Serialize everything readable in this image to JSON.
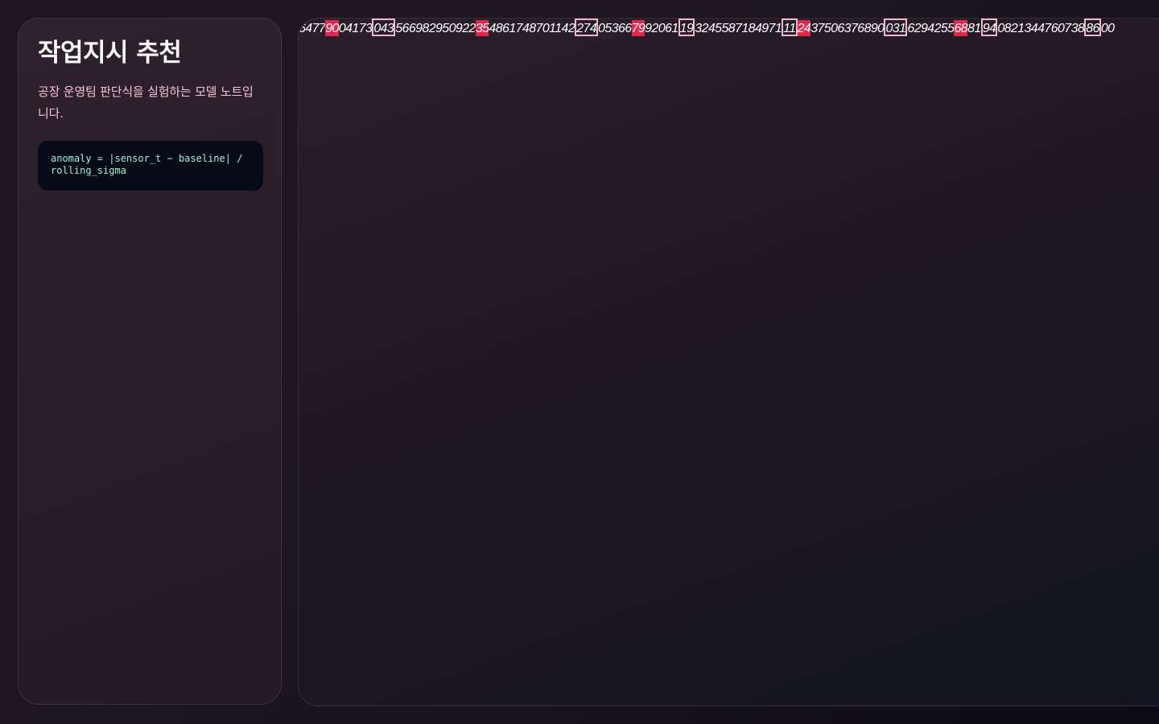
{
  "sidebar": {
    "title": "작업지시 추천",
    "description": "공장 운영팀 판단식을 실험하는 모델 노트입니다.",
    "formula": "anomaly = |sensor_t − baseline| / rolling_sigma"
  },
  "digit_strip": {
    "segments": [
      {
        "text": "6477",
        "style": "plain"
      },
      {
        "text": "90",
        "style": "red"
      },
      {
        "text": "04173",
        "style": "plain"
      },
      {
        "text": "043",
        "style": "box"
      },
      {
        "text": "5669829509",
        "style": "plain"
      },
      {
        "text": "22",
        "style": "plain"
      },
      {
        "text": "35",
        "style": "red"
      },
      {
        "text": "4861748701142",
        "style": "plain"
      },
      {
        "text": "274",
        "style": "box"
      },
      {
        "text": "05366",
        "style": "plain"
      },
      {
        "text": "79",
        "style": "red"
      },
      {
        "text": "92061",
        "style": "plain"
      },
      {
        "text": "19",
        "style": "box"
      },
      {
        "text": "3245587184971",
        "style": "plain"
      },
      {
        "text": "11",
        "style": "box"
      },
      {
        "text": "24",
        "style": "red"
      },
      {
        "text": "37506376890",
        "style": "plain"
      },
      {
        "text": "031",
        "style": "box"
      },
      {
        "text": "6294255",
        "style": "plain"
      },
      {
        "text": "68",
        "style": "red"
      },
      {
        "text": "81",
        "style": "plain"
      },
      {
        "text": "94",
        "style": "box"
      },
      {
        "text": "0821344760738",
        "style": "plain"
      },
      {
        "text": "86",
        "style": "box"
      },
      {
        "text": "00",
        "style": "plain"
      }
    ]
  },
  "colors": {
    "highlight_red": "#e0284e",
    "highlight_box": "#f3b7cc",
    "description_text": "#f6c3d4",
    "formula_text": "#9ff3d6"
  }
}
